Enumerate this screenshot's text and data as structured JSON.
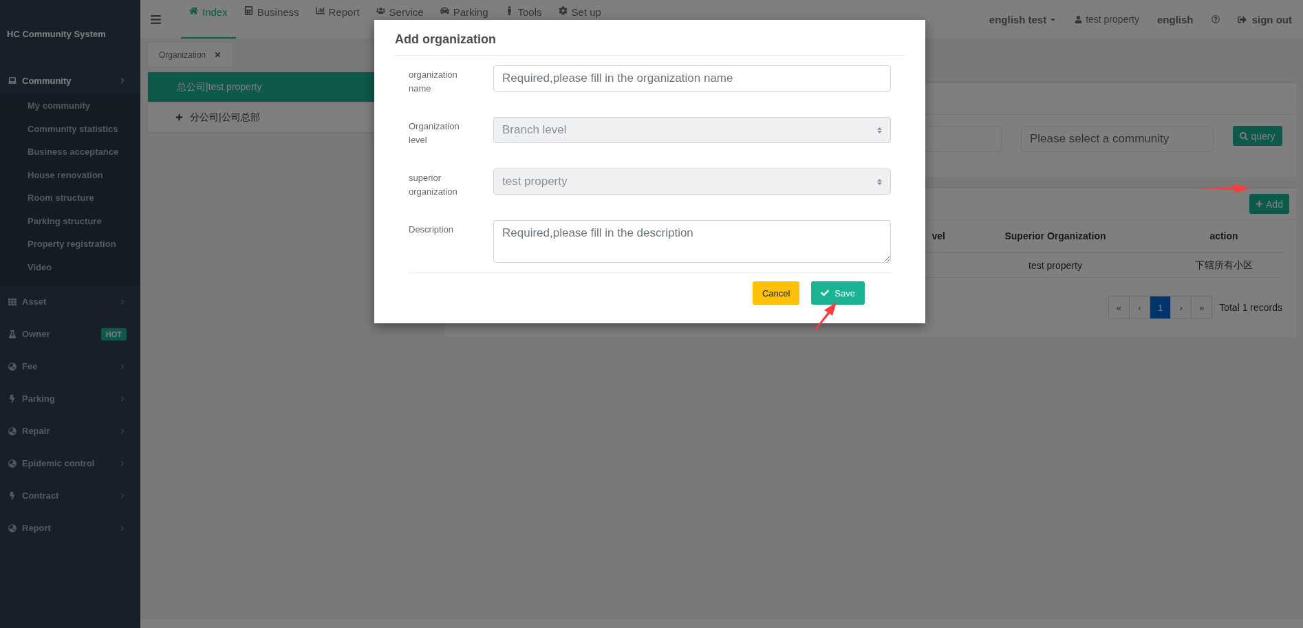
{
  "sidebar": {
    "brand": "HC Community System",
    "items": [
      {
        "label": "Community",
        "expanded": true,
        "children": [
          "My community",
          "Community statistics",
          "Business acceptance",
          "House renovation",
          "Room structure",
          "Parking structure",
          "Property registration",
          "Video"
        ]
      },
      {
        "label": "Asset",
        "expanded": false
      },
      {
        "label": "Owner",
        "badge": "HOT"
      },
      {
        "label": "Fee",
        "expanded": false
      },
      {
        "label": "Parking",
        "expanded": false
      },
      {
        "label": "Repair",
        "expanded": false
      },
      {
        "label": "Epidemic control",
        "expanded": false
      },
      {
        "label": "Contract",
        "expanded": false
      },
      {
        "label": "Report",
        "expanded": false
      }
    ]
  },
  "topbar": {
    "nav": [
      {
        "label": "Index",
        "selected": true
      },
      {
        "label": "Business",
        "selected": false
      },
      {
        "label": "Report",
        "selected": false
      },
      {
        "label": "Service",
        "selected": false
      },
      {
        "label": "Parking",
        "selected": false
      },
      {
        "label": "Tools",
        "selected": false
      },
      {
        "label": "Set up",
        "selected": false
      }
    ],
    "user_menu": "english test",
    "property": "test property",
    "language": "english",
    "sign_out": "sign out"
  },
  "tabs": [
    {
      "label": "Organization",
      "selected": true
    }
  ],
  "org_tree": [
    {
      "label": "总公司|test property",
      "selected": true,
      "has_children": false
    },
    {
      "label": "分公司|公司总部",
      "selected": false,
      "has_children": true
    }
  ],
  "search": {
    "community_placeholder": "Please select a community",
    "query_button": "query"
  },
  "table": {
    "add_button": "Add",
    "columns": [
      "vel",
      "Superior Organization",
      "action"
    ],
    "rows": [
      [
        "",
        "test property",
        "下辖所有小区"
      ]
    ]
  },
  "pagination": {
    "pages": [
      {
        "label": "«",
        "selected": false
      },
      {
        "label": "‹",
        "selected": false
      },
      {
        "label": "1",
        "selected": true
      },
      {
        "label": "›",
        "selected": false
      },
      {
        "label": "»",
        "selected": false
      }
    ],
    "total": "Total 1 records"
  },
  "modal": {
    "title": "Add organization",
    "fields": [
      {
        "label": "organization name",
        "kind": "input",
        "placeholder": "Required,please fill in the organization name"
      },
      {
        "label": "Organization level",
        "kind": "select",
        "value": "Branch level",
        "disabled": true
      },
      {
        "label": "superior organization",
        "kind": "select",
        "value": "test property",
        "disabled": true
      },
      {
        "label": "Description",
        "kind": "textarea",
        "placeholder": "Required,please fill in the description"
      }
    ],
    "buttons": [
      {
        "label": "Cancel",
        "kind": "cancel"
      },
      {
        "label": "Save",
        "kind": "save"
      }
    ]
  }
}
